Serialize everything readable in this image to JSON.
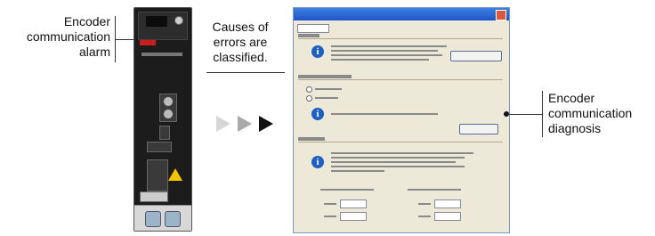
{
  "labels": {
    "encoder_alarm": [
      "Encoder",
      "communication",
      "alarm"
    ],
    "causes": [
      "Causes of",
      "errors are",
      "classified."
    ],
    "diagnosis": [
      "Encoder",
      "communication",
      "diagnosis"
    ]
  },
  "colors": {
    "arrow_light": "#d7d7d7",
    "arrow_mid": "#a9a9a9",
    "arrow_dark": "#111111"
  },
  "icons": {
    "dialog_info": "i"
  }
}
